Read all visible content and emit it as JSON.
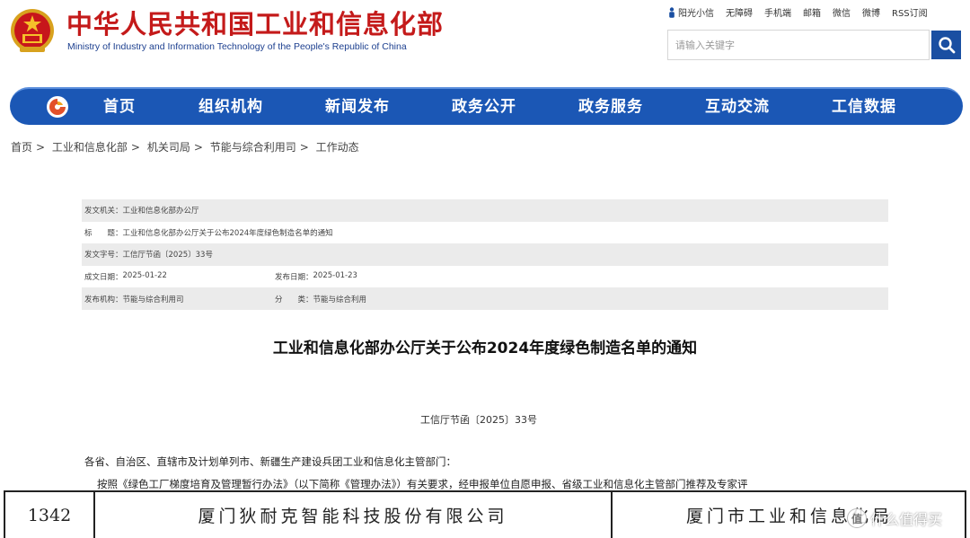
{
  "header": {
    "title": "中华人民共和国工业和信息化部",
    "subtitle": "Ministry of Industry and Information Technology of the People's Republic of China",
    "top_links": [
      "阳光小信",
      "无障碍",
      "手机端",
      "邮箱",
      "微信",
      "微博",
      "RSS订阅"
    ],
    "search_placeholder": "请输入关键字"
  },
  "nav": {
    "items": [
      "首页",
      "组织机构",
      "新闻发布",
      "政务公开",
      "政务服务",
      "互动交流",
      "工信数据"
    ]
  },
  "breadcrumb": [
    "首页",
    "工业和信息化部",
    "机关司局",
    "节能与综合利用司",
    "工作动态"
  ],
  "meta": {
    "issuer_label": "发文机关：",
    "issuer": "工业和信息化部办公厅",
    "title_label": "标　　题：",
    "title": "工业和信息化部办公厅关于公布2024年度绿色制造名单的通知",
    "doc_no_label": "发文字号：",
    "doc_no": "工信厅节函〔2025〕33号",
    "written_label": "成文日期：",
    "written_date": "2025-01-22",
    "published_label": "发布日期：",
    "published_date": "2025-01-23",
    "org_label": "发布机构：",
    "org": "节能与综合利用司",
    "category_label": "分　　类：",
    "category": "节能与综合利用"
  },
  "document": {
    "title": "工业和信息化部办公厅关于公布2024年度绿色制造名单的通知",
    "number": "工信厅节函〔2025〕33号",
    "greeting": "各省、自治区、直辖市及计划单列市、新疆生产建设兵团工业和信息化主管部门：",
    "paragraph": "按照《绿色工厂梯度培育及管理暂行办法》（以下简称《管理办法》）有关要求，经申报单位自愿申报、省级工业和信息化主管部门推荐及专家评"
  },
  "list_row": {
    "index": "1342",
    "company": "厦门狄耐克智能科技股份有限公司",
    "authority": "厦门市工业和信息化局"
  },
  "watermark": "什么值得买",
  "colors": {
    "brand_red": "#c41a1a",
    "nav_blue": "#1b57b5",
    "search_blue": "#1a4fa2"
  }
}
